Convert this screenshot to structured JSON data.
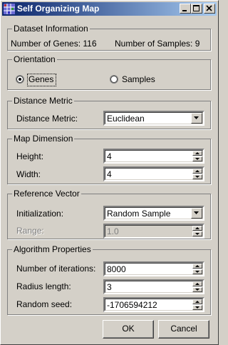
{
  "window": {
    "title": "Self Organizing Map"
  },
  "dataset": {
    "legend": "Dataset Information",
    "genes_text": "Number of Genes: 116",
    "samples_text": "Number of Samples: 9"
  },
  "orientation": {
    "legend": "Orientation",
    "options": [
      {
        "label": "Genes",
        "selected": true
      },
      {
        "label": "Samples",
        "selected": false
      }
    ]
  },
  "distance": {
    "legend": "Distance Metric",
    "label": "Distance Metric:",
    "value": "Euclidean"
  },
  "dimension": {
    "legend": "Map Dimension",
    "height_label": "Height:",
    "height_value": "4",
    "width_label": "Width:",
    "width_value": "4"
  },
  "reference": {
    "legend": "Reference Vector",
    "init_label": "Initialization:",
    "init_value": "Random Sample",
    "range_label": "Range:",
    "range_value": "1.0"
  },
  "algorithm": {
    "legend": "Algorithm Properties",
    "iterations_label": "Number of iterations:",
    "iterations_value": "8000",
    "radius_label": "Radius length:",
    "radius_value": "3",
    "seed_label": "Random seed:",
    "seed_value": "-1706594212"
  },
  "buttons": {
    "ok": "OK",
    "cancel": "Cancel"
  },
  "icons": {
    "app": "grid-map-icon",
    "minimize": "minimize-icon",
    "maximize": "maximize-icon",
    "close": "close-icon"
  },
  "colors": {
    "titlebar_start": "#0a246a",
    "titlebar_end": "#a6caf0",
    "face": "#d4d0c8"
  }
}
